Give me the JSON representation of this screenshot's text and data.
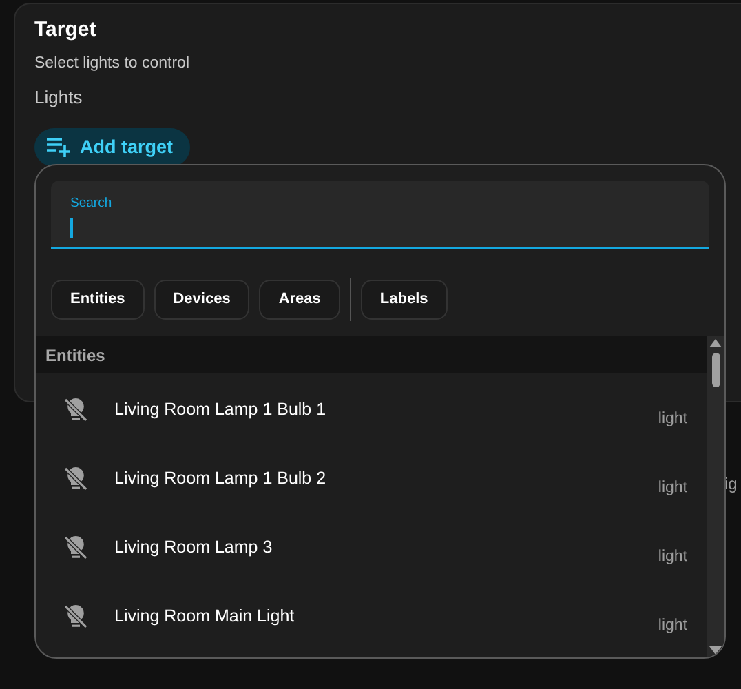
{
  "card": {
    "title": "Target",
    "description": "Select lights to control",
    "field_label": "Lights",
    "add_button": "Add target"
  },
  "background_text": "ig",
  "picker": {
    "search": {
      "label": "Search",
      "focused": true
    },
    "filters": [
      "Entities",
      "Devices",
      "Areas"
    ],
    "label_filters": [
      "Labels"
    ],
    "section": "Entities",
    "items": [
      {
        "name": "Living Room Lamp 1 Bulb 1",
        "domain": "light"
      },
      {
        "name": "Living Room Lamp 1 Bulb 2",
        "domain": "light"
      },
      {
        "name": "Living Room Lamp 3",
        "domain": "light"
      },
      {
        "name": "Living Room Main Light",
        "domain": "light"
      }
    ]
  }
}
